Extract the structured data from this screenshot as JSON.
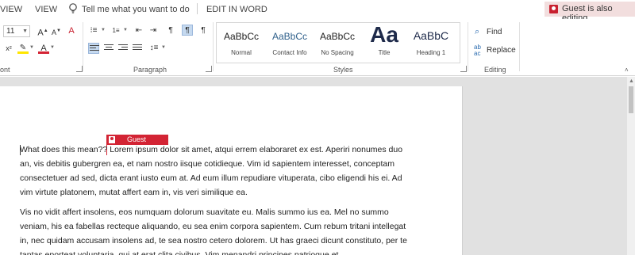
{
  "menubar": {
    "view_cut": "VIEW",
    "view": "VIEW",
    "tell_me": "Tell me what you want to do",
    "edit_in_word": "EDIT IN WORD",
    "guest_editing": "Guest is also editing"
  },
  "ribbon": {
    "font_size": "11",
    "groups": {
      "font_cut": "ont",
      "paragraph": "Paragraph",
      "styles": "Styles",
      "editing": "Editing"
    },
    "styles": [
      {
        "sample": "AaBbCc",
        "name": "Normal"
      },
      {
        "sample": "AaBbCc",
        "name": "Contact Info"
      },
      {
        "sample": "AaBbCc",
        "name": "No Spacing"
      },
      {
        "sample": "Aa",
        "name": "Title"
      },
      {
        "sample": "AaBbC",
        "name": "Heading 1"
      }
    ],
    "editing": {
      "find": "Find",
      "replace": "Replace"
    }
  },
  "document": {
    "guest_tag": "Guest",
    "para1": [
      "What does this mean?? Lorem ipsum dolor sit amet, atqui errem elaboraret ex est. Aperiri nonumes duo",
      "an, vis debitis gubergren ea, et nam nostro iisque cotidieque. Vim id sapientem interesset, conceptam",
      "consectetuer ad sed, dicta erant iusto eum at. Ad eum illum repudiare vituperata, cibo eligendi his ei. Ad",
      "vim virtute platonem, mutat affert eam in, vis veri similique ea."
    ],
    "para2": [
      "Vis no vidit affert insolens, eos numquam dolorum suavitate eu. Malis summo ius ea. Mel no summo",
      "veniam, his ea fabellas recteque aliquando, eu sea enim corpora sapientem. Cum rebum tritani intellegat",
      "in, nec quidam accusam insolens ad, te sea nostro cetero dolorem. Ut has graeci dicunt constituto, per te",
      "tantas eporteat voluptaria, qui at erat clita civibus. Vim menandri principes patrioque et."
    ]
  },
  "colors": {
    "accent": "#d32434",
    "highlight": "#ffe600",
    "font_color": "#d32434",
    "active_button": "#c5d9ef"
  }
}
